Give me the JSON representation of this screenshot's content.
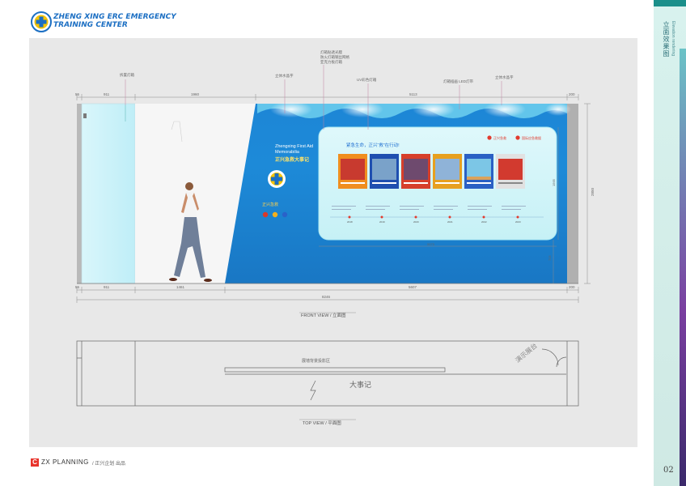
{
  "header": {
    "logo_title": "ZHENG XING ERC EMERGENCY\nTRAINING CENTER"
  },
  "sidebar": {
    "title_cn": "立面效果图",
    "title_en": "Elevation rendering",
    "page_number": "02"
  },
  "footer": {
    "brand": "ZX PLANNING",
    "sub": "/ 正兴企划 出品"
  },
  "front_view": {
    "label": "FRONT VIEW / 立面图",
    "callouts": [
      "拆置灯箱",
      "立体水晶字",
      "灯箱贴透光膜\n防火灯箱钢丝网格\n亚克力板灯箱",
      "UV彩色灯箱",
      "灯箱插画 LED灯带",
      "立体水晶字"
    ],
    "dims_top": [
      "55",
      "911",
      "1960",
      "5113",
      "200"
    ],
    "dims_bottom": [
      "55",
      "911",
      "1461",
      "5607",
      "200"
    ],
    "dim_total": "8246",
    "dim_height": "2850",
    "dim_panel_h": "1565",
    "dim_panel_w": "5573",
    "dim_lower": "705"
  },
  "wall": {
    "title_en": "Zhengxing First Aid\nMemorabilia",
    "title_cn": "正兴急救大事记",
    "brand_marks": "正兴急救",
    "board_heading": "紧急生命，正兴“救”在行动!",
    "board_logo_a": "正兴急救",
    "board_logo_b": "国际应急救援",
    "timeline_years": [
      "2018",
      "2019",
      "2020",
      "2021",
      "2022",
      "2023"
    ]
  },
  "top_view": {
    "label": "TOP VIEW / 平面图",
    "text_a": "展墙背景投影区",
    "text_b": "大事记",
    "text_c": "演示展台"
  }
}
